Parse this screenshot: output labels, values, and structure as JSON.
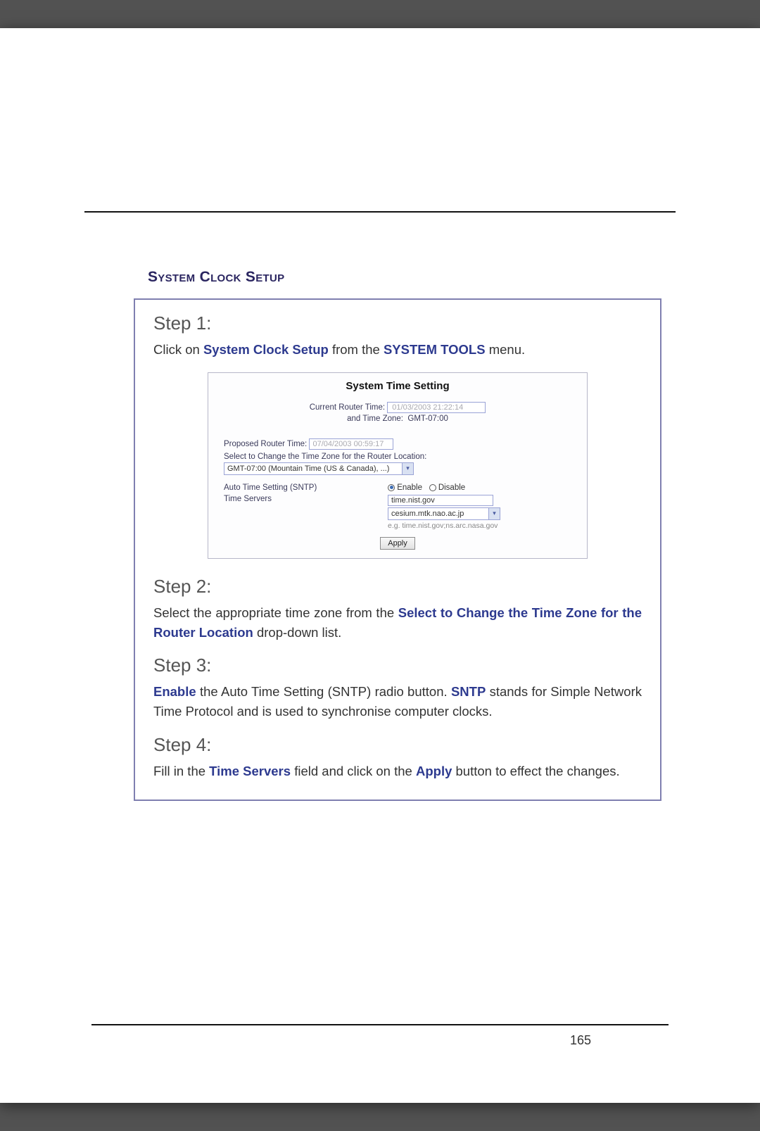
{
  "section_title": "System Clock Setup",
  "page_number": "165",
  "steps": {
    "s1": {
      "head": "Step 1:",
      "t1": "Click on ",
      "link": "System Clock Setup",
      "t2": " from the ",
      "bold": "SYSTEM TOOLS",
      "t3": " menu."
    },
    "s2": {
      "head": "Step 2:",
      "t1": "Select the appropriate time zone from the ",
      "link": "Select to Change the Time Zone for the Router Location",
      "t2": " drop-down list."
    },
    "s3": {
      "head": "Step 3:",
      "link1": "Enable",
      "t1": " the Auto Time Setting (SNTP) radio button. ",
      "link2": "SNTP",
      "t2": " stands for Simple Network Time Protocol and is used to synchronise computer clocks."
    },
    "s4": {
      "head": "Step 4:",
      "t1": "Fill in the ",
      "link1": "Time Servers",
      "t2": " field and click on the ",
      "link2": "Apply",
      "t3": " button to effect the changes."
    }
  },
  "panel": {
    "title": "System Time Setting",
    "current_label": "Current Router Time:",
    "current_value": "01/03/2003 21:22:14",
    "tz_label": "and Time Zone:",
    "tz_value": "GMT-07:00",
    "proposed_label": "Proposed Router Time:",
    "proposed_value": "07/04/2003 00:59:17",
    "select_tz_label": "Select to Change the Time Zone for the Router Location:",
    "select_tz_value": "GMT-07:00 (Mountain Time (US & Canada), ...)",
    "auto_label": "Auto Time Setting (SNTP)",
    "enable": "Enable",
    "disable": "Disable",
    "servers_label": "Time Servers",
    "server_input": "time.nist.gov",
    "server_select": "cesium.mtk.nao.ac.jp",
    "server_eg": "e.g. time.nist.gov;ns.arc.nasa.gov",
    "apply": "Apply"
  }
}
